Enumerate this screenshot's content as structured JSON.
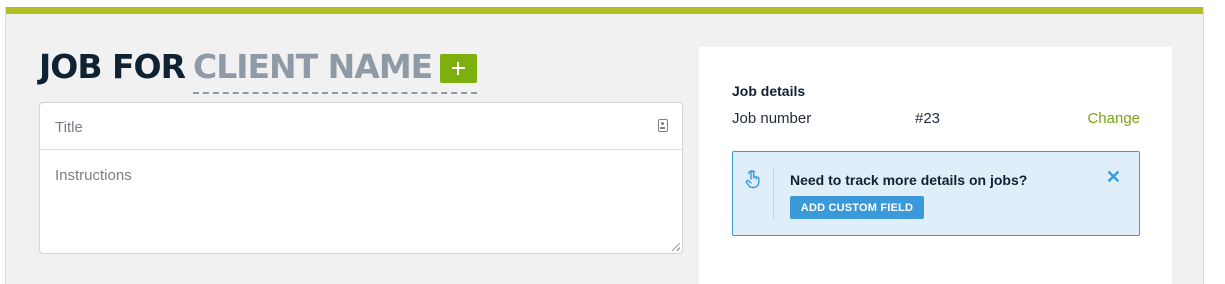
{
  "header": {
    "prefix": "JOB FOR",
    "client_placeholder": "CLIENT NAME",
    "add_icon": "plus-icon"
  },
  "form": {
    "title_placeholder": "Title",
    "title_icon": "contact-card-icon",
    "instructions_placeholder": "Instructions"
  },
  "job_details": {
    "heading": "Job details",
    "number_label": "Job number",
    "number_value": "#23",
    "change_label": "Change"
  },
  "notice": {
    "icon": "pointing-hand-icon",
    "message": "Need to track more details on jobs?",
    "button_label": "ADD CUSTOM FIELD",
    "close_icon": "close-icon"
  },
  "colors": {
    "accent_bar": "#b3bd22",
    "brand_green": "#7db00e",
    "info_blue": "#3a9ad9",
    "info_bg": "#dfeef8",
    "heading_dark": "#0f2233",
    "placeholder_gray": "#8e9ba6"
  }
}
